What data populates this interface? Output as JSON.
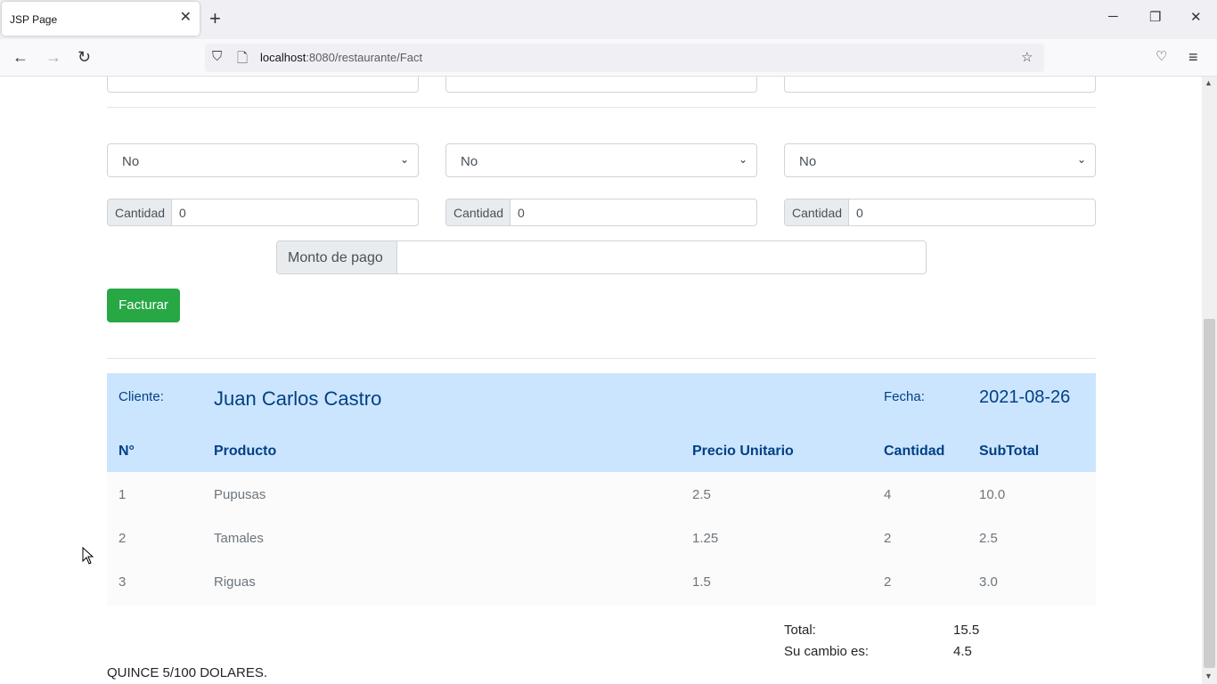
{
  "browser": {
    "tab_title": "JSP Page",
    "url_host": "localhost",
    "url_rest": ":8080/restaurante/Fact"
  },
  "form": {
    "selects": [
      "No",
      "No",
      "No"
    ],
    "quantity_label": "Cantidad",
    "quantities": [
      "0",
      "0",
      "0"
    ],
    "payment_label": "Monto de pago",
    "payment_value": "",
    "submit_label": "Facturar"
  },
  "invoice": {
    "client_label": "Cliente:",
    "client_name": "Juan Carlos Castro",
    "date_label": "Fecha:",
    "date": "2021-08-26",
    "columns": [
      "N°",
      "Producto",
      "Precio Unitario",
      "Cantidad",
      "SubTotal"
    ],
    "rows": [
      {
        "n": "1",
        "product": "Pupusas",
        "price": "2.5",
        "qty": "4",
        "subtotal": "10.0"
      },
      {
        "n": "2",
        "product": "Tamales",
        "price": "1.25",
        "qty": "2",
        "subtotal": "2.5"
      },
      {
        "n": "3",
        "product": "Riguas",
        "price": "1.5",
        "qty": "2",
        "subtotal": "3.0"
      }
    ],
    "total_label": "Total:",
    "total": "15.5",
    "change_label": "Su cambio es:",
    "change": "4.5",
    "amount_words": "QUINCE 5/100 DOLARES."
  }
}
